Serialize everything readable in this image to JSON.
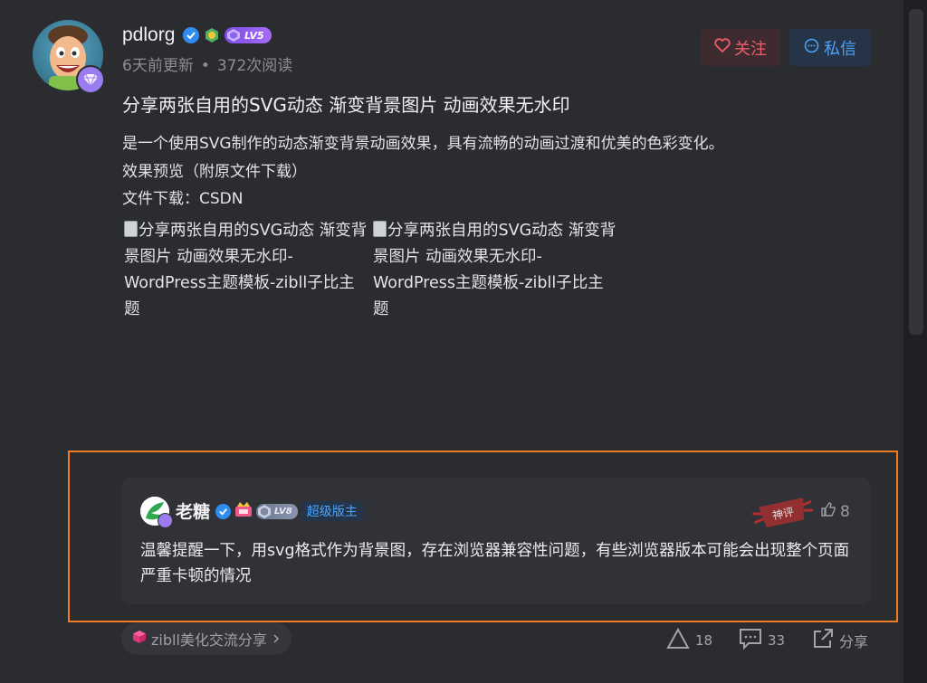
{
  "author": {
    "name": "pdlorg",
    "level": "LV5",
    "updated": "6天前更新",
    "views": "372次阅读"
  },
  "actions": {
    "follow": "关注",
    "message": "私信"
  },
  "post": {
    "title": "分享两张自用的SVG动态 渐变背景图片 动画效果无水印",
    "lines": [
      "是一个使用SVG制作的动态渐变背景动画效果，具有流畅的动画过渡和优美的色彩变化。",
      "效果预览（附原文件下载）",
      "文件下载：CSDN"
    ],
    "image_alts": [
      "分享两张自用的SVG动态 渐变背景图片 动画效果无水印-WordPress主题模板-zibll子比主题",
      "分享两张自用的SVG动态 渐变背景图片 动画效果无水印-WordPress主题模板-zibll子比主题"
    ]
  },
  "comment": {
    "name": "老糖",
    "level": "LV8",
    "role": "超级版主",
    "likes": "8",
    "stamp": "神评",
    "text": "温馨提醒一下，用svg格式作为背景图，存在浏览器兼容性问题，有些浏览器版本可能会出现整个页面严重卡顿的情况"
  },
  "footer": {
    "topic": "zibll美化交流分享",
    "like_count": "18",
    "comment_count": "33",
    "share_label": "分享"
  },
  "colors": {
    "background": "#2b2c30",
    "highlight_border": "#f07b24",
    "follow": "#f15d6d",
    "message": "#4aa3ff"
  }
}
